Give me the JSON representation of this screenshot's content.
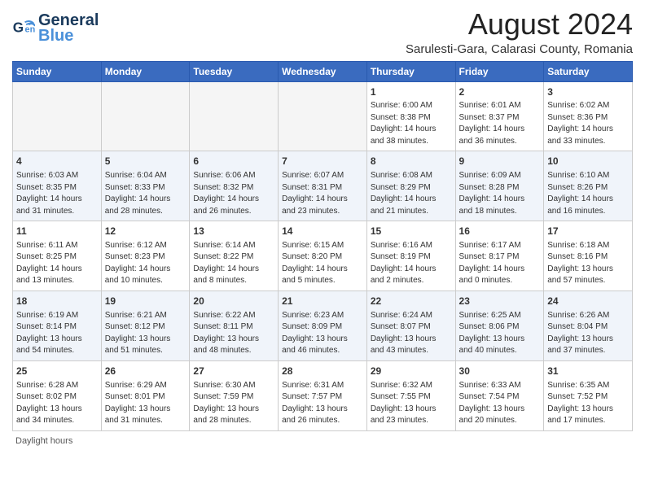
{
  "header": {
    "logo_line1": "General",
    "logo_line2": "Blue",
    "main_title": "August 2024",
    "sub_title": "Sarulesti-Gara, Calarasi County, Romania"
  },
  "weekdays": [
    "Sunday",
    "Monday",
    "Tuesday",
    "Wednesday",
    "Thursday",
    "Friday",
    "Saturday"
  ],
  "weeks": [
    [
      {
        "day": "",
        "info": ""
      },
      {
        "day": "",
        "info": ""
      },
      {
        "day": "",
        "info": ""
      },
      {
        "day": "",
        "info": ""
      },
      {
        "day": "1",
        "info": "Sunrise: 6:00 AM\nSunset: 8:38 PM\nDaylight: 14 hours\nand 38 minutes."
      },
      {
        "day": "2",
        "info": "Sunrise: 6:01 AM\nSunset: 8:37 PM\nDaylight: 14 hours\nand 36 minutes."
      },
      {
        "day": "3",
        "info": "Sunrise: 6:02 AM\nSunset: 8:36 PM\nDaylight: 14 hours\nand 33 minutes."
      }
    ],
    [
      {
        "day": "4",
        "info": "Sunrise: 6:03 AM\nSunset: 8:35 PM\nDaylight: 14 hours\nand 31 minutes."
      },
      {
        "day": "5",
        "info": "Sunrise: 6:04 AM\nSunset: 8:33 PM\nDaylight: 14 hours\nand 28 minutes."
      },
      {
        "day": "6",
        "info": "Sunrise: 6:06 AM\nSunset: 8:32 PM\nDaylight: 14 hours\nand 26 minutes."
      },
      {
        "day": "7",
        "info": "Sunrise: 6:07 AM\nSunset: 8:31 PM\nDaylight: 14 hours\nand 23 minutes."
      },
      {
        "day": "8",
        "info": "Sunrise: 6:08 AM\nSunset: 8:29 PM\nDaylight: 14 hours\nand 21 minutes."
      },
      {
        "day": "9",
        "info": "Sunrise: 6:09 AM\nSunset: 8:28 PM\nDaylight: 14 hours\nand 18 minutes."
      },
      {
        "day": "10",
        "info": "Sunrise: 6:10 AM\nSunset: 8:26 PM\nDaylight: 14 hours\nand 16 minutes."
      }
    ],
    [
      {
        "day": "11",
        "info": "Sunrise: 6:11 AM\nSunset: 8:25 PM\nDaylight: 14 hours\nand 13 minutes."
      },
      {
        "day": "12",
        "info": "Sunrise: 6:12 AM\nSunset: 8:23 PM\nDaylight: 14 hours\nand 10 minutes."
      },
      {
        "day": "13",
        "info": "Sunrise: 6:14 AM\nSunset: 8:22 PM\nDaylight: 14 hours\nand 8 minutes."
      },
      {
        "day": "14",
        "info": "Sunrise: 6:15 AM\nSunset: 8:20 PM\nDaylight: 14 hours\nand 5 minutes."
      },
      {
        "day": "15",
        "info": "Sunrise: 6:16 AM\nSunset: 8:19 PM\nDaylight: 14 hours\nand 2 minutes."
      },
      {
        "day": "16",
        "info": "Sunrise: 6:17 AM\nSunset: 8:17 PM\nDaylight: 14 hours\nand 0 minutes."
      },
      {
        "day": "17",
        "info": "Sunrise: 6:18 AM\nSunset: 8:16 PM\nDaylight: 13 hours\nand 57 minutes."
      }
    ],
    [
      {
        "day": "18",
        "info": "Sunrise: 6:19 AM\nSunset: 8:14 PM\nDaylight: 13 hours\nand 54 minutes."
      },
      {
        "day": "19",
        "info": "Sunrise: 6:21 AM\nSunset: 8:12 PM\nDaylight: 13 hours\nand 51 minutes."
      },
      {
        "day": "20",
        "info": "Sunrise: 6:22 AM\nSunset: 8:11 PM\nDaylight: 13 hours\nand 48 minutes."
      },
      {
        "day": "21",
        "info": "Sunrise: 6:23 AM\nSunset: 8:09 PM\nDaylight: 13 hours\nand 46 minutes."
      },
      {
        "day": "22",
        "info": "Sunrise: 6:24 AM\nSunset: 8:07 PM\nDaylight: 13 hours\nand 43 minutes."
      },
      {
        "day": "23",
        "info": "Sunrise: 6:25 AM\nSunset: 8:06 PM\nDaylight: 13 hours\nand 40 minutes."
      },
      {
        "day": "24",
        "info": "Sunrise: 6:26 AM\nSunset: 8:04 PM\nDaylight: 13 hours\nand 37 minutes."
      }
    ],
    [
      {
        "day": "25",
        "info": "Sunrise: 6:28 AM\nSunset: 8:02 PM\nDaylight: 13 hours\nand 34 minutes."
      },
      {
        "day": "26",
        "info": "Sunrise: 6:29 AM\nSunset: 8:01 PM\nDaylight: 13 hours\nand 31 minutes."
      },
      {
        "day": "27",
        "info": "Sunrise: 6:30 AM\nSunset: 7:59 PM\nDaylight: 13 hours\nand 28 minutes."
      },
      {
        "day": "28",
        "info": "Sunrise: 6:31 AM\nSunset: 7:57 PM\nDaylight: 13 hours\nand 26 minutes."
      },
      {
        "day": "29",
        "info": "Sunrise: 6:32 AM\nSunset: 7:55 PM\nDaylight: 13 hours\nand 23 minutes."
      },
      {
        "day": "30",
        "info": "Sunrise: 6:33 AM\nSunset: 7:54 PM\nDaylight: 13 hours\nand 20 minutes."
      },
      {
        "day": "31",
        "info": "Sunrise: 6:35 AM\nSunset: 7:52 PM\nDaylight: 13 hours\nand 17 minutes."
      }
    ]
  ],
  "footer": {
    "daylight_label": "Daylight hours"
  }
}
